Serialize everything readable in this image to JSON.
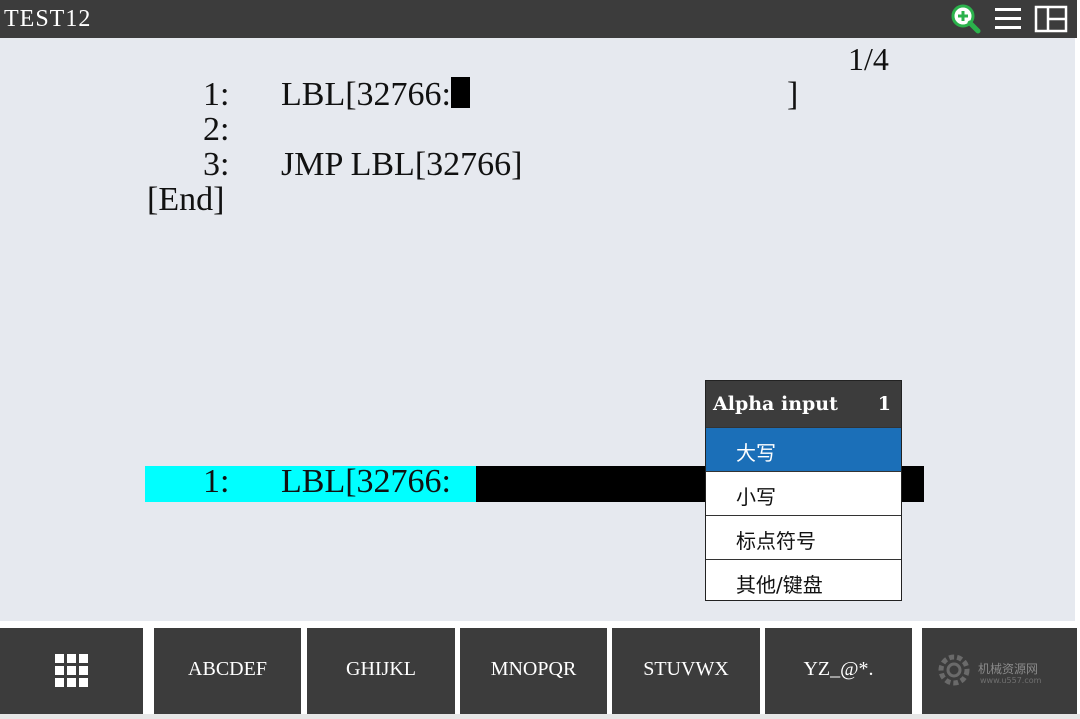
{
  "window": {
    "title": "TEST12"
  },
  "header_icons": [
    "zoom-in-icon",
    "menu-icon",
    "split-window-icon"
  ],
  "editor": {
    "page": "1/4",
    "lines": [
      {
        "num": "1:",
        "code": "LBL[32766:",
        "close": "]"
      },
      {
        "num": "2:",
        "code": ""
      },
      {
        "num": "3:",
        "code": "JMP LBL[32766]"
      }
    ],
    "end_marker": "[End]",
    "edit_line": {
      "num": "1:",
      "code": "LBL[32766:"
    }
  },
  "popup": {
    "title": "Alpha input",
    "number": "1",
    "items": [
      "大写",
      "小写",
      "标点符号",
      "其他/键盘"
    ],
    "selected_index": 0
  },
  "function_keys": [
    "ABCDEF",
    "GHIJKL",
    "MNOPQR",
    "STUVWX",
    "YZ_@*."
  ],
  "colors": {
    "title_bar": "#3c3c3c",
    "background": "#e6e9ef",
    "edit_highlight": "#00ffff",
    "popup_selected": "#1b6fb8",
    "icon_green": "#2bb24c"
  },
  "watermark": {
    "text": "机械资源网",
    "subtext": "www.u557.com"
  }
}
